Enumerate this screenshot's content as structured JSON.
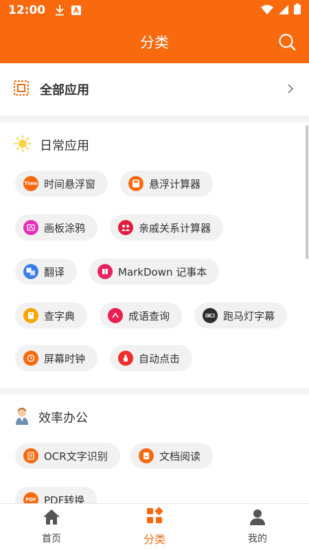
{
  "status_bar": {
    "time": "12:00"
  },
  "app_bar": {
    "title": "分类"
  },
  "all_apps": {
    "label": "全部应用"
  },
  "sections": [
    {
      "title": "日常应用",
      "icon": "sun-icon",
      "items": [
        {
          "label": "时间悬浮窗",
          "icon": "time-icon",
          "icon_text": "Time",
          "color": "#f96a0e"
        },
        {
          "label": "悬浮计算器",
          "icon": "calculator-icon",
          "icon_text": "",
          "color": "#f96a0e"
        },
        {
          "label": "画板涂鸦",
          "icon": "drawing-board-icon",
          "icon_text": "",
          "color": "#e52fb8"
        },
        {
          "label": "亲戚关系计算器",
          "icon": "relatives-icon",
          "icon_text": "",
          "color": "#e01e3c"
        },
        {
          "label": "翻译",
          "icon": "translate-icon",
          "icon_text": "",
          "color": "#3b7de8"
        },
        {
          "label": "MarkDown 记事本",
          "icon": "markdown-icon",
          "icon_text": "",
          "color": "#e8245c"
        },
        {
          "label": "查字典",
          "icon": "dictionary-icon",
          "icon_text": "",
          "color": "#f5a700"
        },
        {
          "label": "成语查询",
          "icon": "idiom-icon",
          "icon_text": "",
          "color": "#ea1f52"
        },
        {
          "label": "跑马灯字幕",
          "icon": "marquee-icon",
          "icon_text": "",
          "color": "#2d2d2d"
        },
        {
          "label": "屏幕时钟",
          "icon": "clock-icon",
          "icon_text": "",
          "color": "#f96a0e"
        },
        {
          "label": "自动点击",
          "icon": "auto-click-icon",
          "icon_text": "",
          "color": "#ef2e2e"
        }
      ]
    },
    {
      "title": "效率办公",
      "icon": "office-worker-icon",
      "items": [
        {
          "label": "OCR文字识别",
          "icon": "ocr-icon",
          "icon_text": "",
          "color": "#f96a0e"
        },
        {
          "label": "文档阅读",
          "icon": "document-icon",
          "icon_text": "",
          "color": "#f96a0e"
        },
        {
          "label": "PDF转换",
          "icon": "pdf-icon",
          "icon_text": "PDF",
          "color": "#f96a0e"
        }
      ]
    }
  ],
  "bottom_nav": [
    {
      "label": "首页",
      "icon": "home-icon",
      "active": false
    },
    {
      "label": "分类",
      "icon": "category-icon",
      "active": true
    },
    {
      "label": "我的",
      "icon": "profile-icon",
      "active": false
    }
  ],
  "colors": {
    "accent": "#f96a0e",
    "background": "#f4f4f4",
    "chip": "#f1f1f1"
  }
}
